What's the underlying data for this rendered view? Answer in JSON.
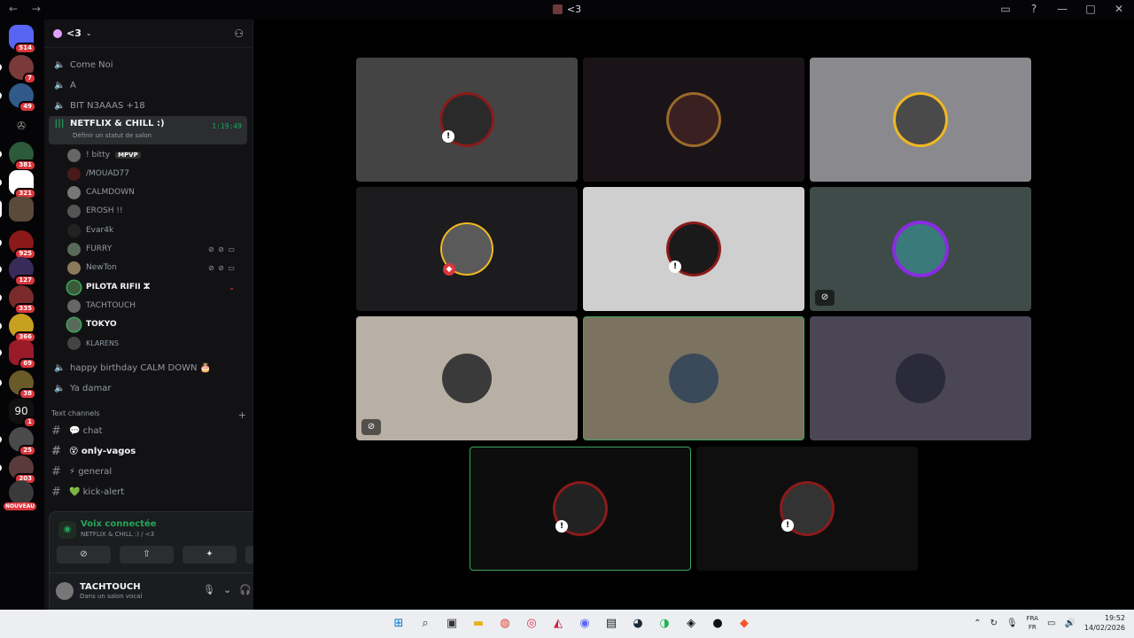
{
  "window": {
    "title": "<3",
    "nav": "← →",
    "controls": [
      "▭",
      "?",
      "—",
      "□",
      "✕"
    ]
  },
  "guild_badges": [
    "514",
    "7",
    "49",
    "381",
    "321",
    "925",
    "127",
    "335",
    "366",
    "69",
    "38",
    "1",
    "25",
    "203",
    "NOUVEAU"
  ],
  "server": {
    "name": "<3"
  },
  "voice_channels_top": [
    {
      "label": "Come Noi"
    },
    {
      "label": "A"
    },
    {
      "label": "BIT N3AAAS +18"
    }
  ],
  "active_voice": {
    "label": "NETFLIX & CHILL :)",
    "status": "Définir un statut de salon",
    "time": "1:19:49"
  },
  "members": [
    {
      "name": "! bitty",
      "tag": "MPVP",
      "bright": false
    },
    {
      "name": "/MOUAD77",
      "tag": "",
      "bright": false
    },
    {
      "name": "CALMDOWN",
      "tag": "",
      "bright": false
    },
    {
      "name": "EROSH !!",
      "tag": "",
      "bright": false
    },
    {
      "name": "Evar4k",
      "tag": "",
      "bright": false
    },
    {
      "name": "FURRY",
      "tag": "",
      "bright": false
    },
    {
      "name": "NewTon",
      "tag": "",
      "bright": false
    },
    {
      "name": "PILOTA RIFII ⵣ",
      "tag": "",
      "bright": true
    },
    {
      "name": "TACHTOUCH",
      "tag": "",
      "bright": false
    },
    {
      "name": "TOKYO",
      "tag": "",
      "bright": true
    },
    {
      "name": "KLARENS",
      "tag": "",
      "bright": false
    }
  ],
  "voice_channels_bottom": [
    {
      "label": "happy birthday CALM DOWN 🎂"
    },
    {
      "label": "Ya damar"
    }
  ],
  "text_category": "Text channels",
  "text_channels": [
    {
      "label": "💬 chat",
      "bright": false
    },
    {
      "label": "😵 only-vagos",
      "bright": true
    },
    {
      "label": "⚡ general",
      "bright": false
    },
    {
      "label": "💚 kick-alert",
      "bright": false
    }
  ],
  "voice_panel": {
    "title": "Voix connectée",
    "subtitle": "NETFLIX & CHILL :) / <3"
  },
  "user": {
    "name": "TACHTOUCH",
    "status": "Dans un salon vocal"
  },
  "taskbar": {
    "lang_top": "FRA",
    "lang_bottom": "FR",
    "time": "19:52",
    "date": "14/02/2026"
  },
  "colors": {
    "speaking_border": "#3ba55d",
    "badge_red": "#da373c",
    "connected_green": "#23a55a"
  }
}
